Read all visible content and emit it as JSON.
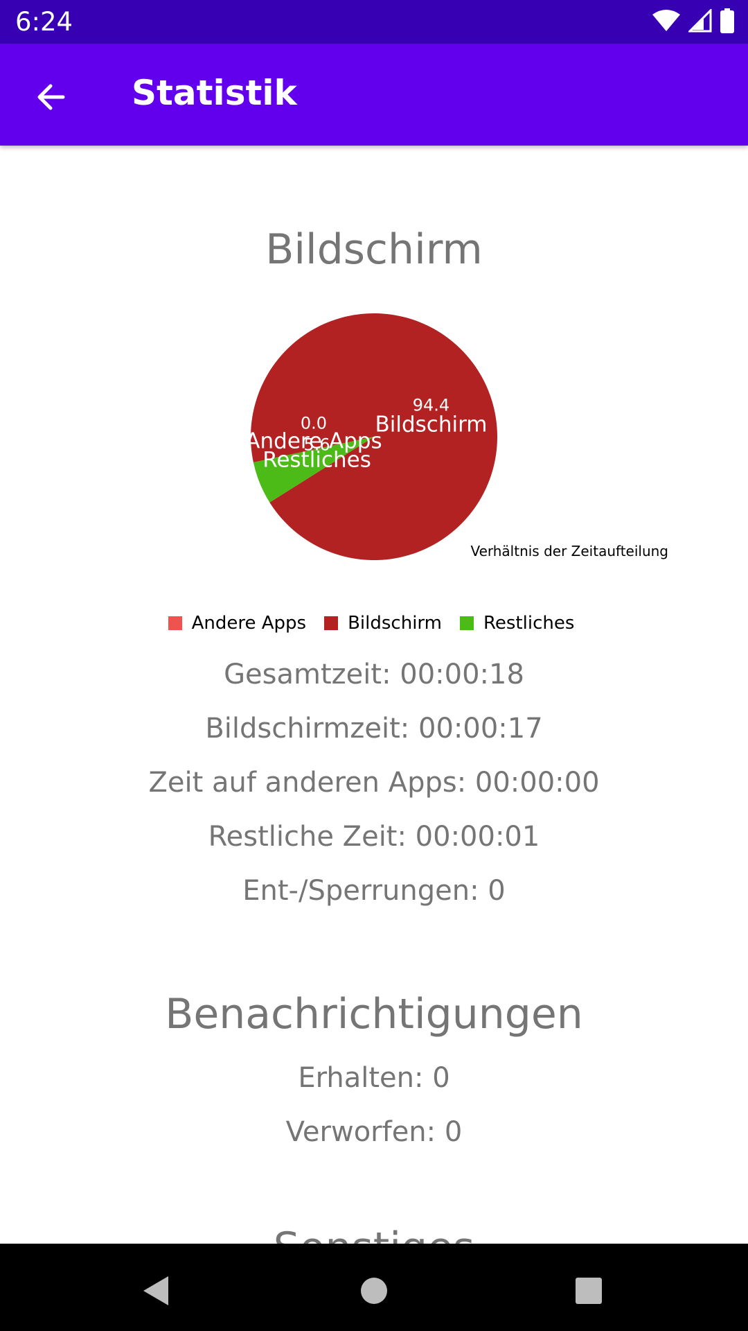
{
  "status_bar": {
    "time": "6:24"
  },
  "app_bar": {
    "title": "Statistik"
  },
  "screen_section": {
    "title": "Bildschirm",
    "chart_description": "Verhältnis der Zeitaufteilung",
    "stats": [
      "Gesamtzeit: 00:00:18",
      "Bildschirmzeit: 00:00:17",
      "Zeit auf anderen Apps: 00:00:00",
      "Restliche Zeit: 00:00:01",
      "Ent-/Sperrungen: 0"
    ]
  },
  "notifications_section": {
    "title": "Benachrichtigungen",
    "stats": [
      "Erhalten: 0",
      "Verworfen: 0"
    ]
  },
  "next_section": {
    "title": "Sonstiges"
  },
  "chart_data": {
    "type": "pie",
    "title": "",
    "description": "Verhältnis der Zeitaufteilung",
    "legend_position": "bottom-center",
    "slices": [
      {
        "label": "Andere Apps",
        "value": 0.0,
        "value_label": "0.0",
        "color": "#ef5350"
      },
      {
        "label": "Bildschirm",
        "value": 94.4,
        "value_label": "94.4",
        "color": "#b22222"
      },
      {
        "label": "Restliches",
        "value": 5.6,
        "value_label": "5.6",
        "color": "#4cbb17"
      }
    ]
  }
}
